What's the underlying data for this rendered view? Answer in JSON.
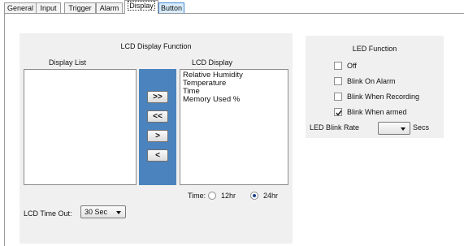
{
  "tabs": [
    {
      "label": "General"
    },
    {
      "label": "Input"
    },
    {
      "label": "Trigger"
    },
    {
      "label": "Alarm"
    },
    {
      "label": "Display"
    },
    {
      "label": "Button"
    }
  ],
  "selected_tab": "Display",
  "lcd_panel": {
    "title": "LCD Display Function",
    "display_list_label": "Display List",
    "lcd_display_label": "LCD Display",
    "display_list_items": [],
    "lcd_display_items": [
      "Relative Humidity",
      "Temperature",
      "Time",
      "Memory Used %"
    ],
    "buttons": {
      "add_all": ">>",
      "remove_all": "<<",
      "add": ">",
      "remove": "<"
    },
    "time_label": "Time:",
    "time_options": [
      {
        "label": "12hr",
        "selected": false
      },
      {
        "label": "24hr",
        "selected": true
      }
    ],
    "timeout_label": "LCD Time Out:",
    "timeout_value": "30 Sec"
  },
  "led_panel": {
    "title": "LED Function",
    "options": [
      {
        "label": "Off",
        "checked": false
      },
      {
        "label": "Blink On Alarm",
        "checked": false
      },
      {
        "label": "Blink When Recording",
        "checked": false
      },
      {
        "label": "Blink When armed",
        "checked": true
      }
    ],
    "blink_rate_label": "LED Blink Rate",
    "blink_rate_value": "",
    "blink_rate_unit": "Secs"
  },
  "colors": {
    "accent_blue": "#4a83bd",
    "panel_bg": "#f0f0f0"
  }
}
